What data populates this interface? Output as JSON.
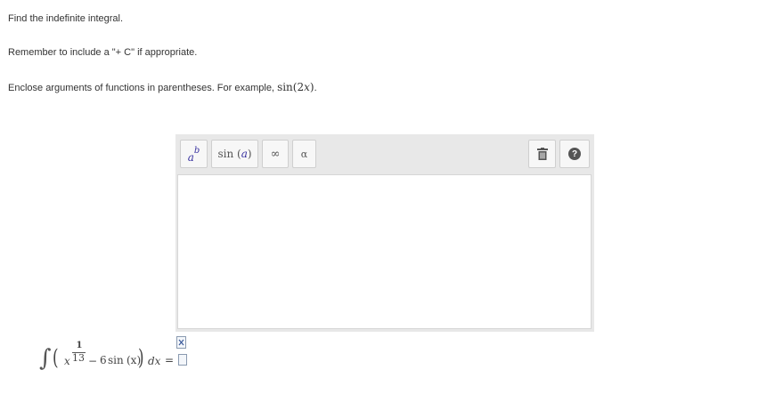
{
  "instructions": {
    "line1": "Find the indefinite integral.",
    "line2": "Remember to include a \"+ C\" if appropriate.",
    "line3_prefix": "Enclose arguments of functions in parentheses. For example,",
    "example_fn": "sin",
    "example_open": "(",
    "example_num": "2",
    "example_var": "x",
    "example_close": ")",
    "example_period": "."
  },
  "toolbar": {
    "power_base": "a",
    "power_exp": "b",
    "func_name": "sin",
    "func_open": "(",
    "func_arg": "a",
    "func_close": ")",
    "infinity": "∞",
    "alpha": "α",
    "trash_icon": "trash-icon",
    "help_symbol": "?"
  },
  "answer": {
    "value": ""
  },
  "problem": {
    "integral_sign": "∫",
    "lparen": "(",
    "base": "x",
    "exp_num": "1",
    "exp_den": "13",
    "minus": "−",
    "coef": "6",
    "fn": "sin",
    "fn_arg": "(x)",
    "rparen": ")",
    "dx": "dx",
    "equals": "="
  },
  "colors": {
    "toolbar_bg": "#e8e8e8",
    "accent": "#3a33a0",
    "help_bg": "#555555"
  }
}
